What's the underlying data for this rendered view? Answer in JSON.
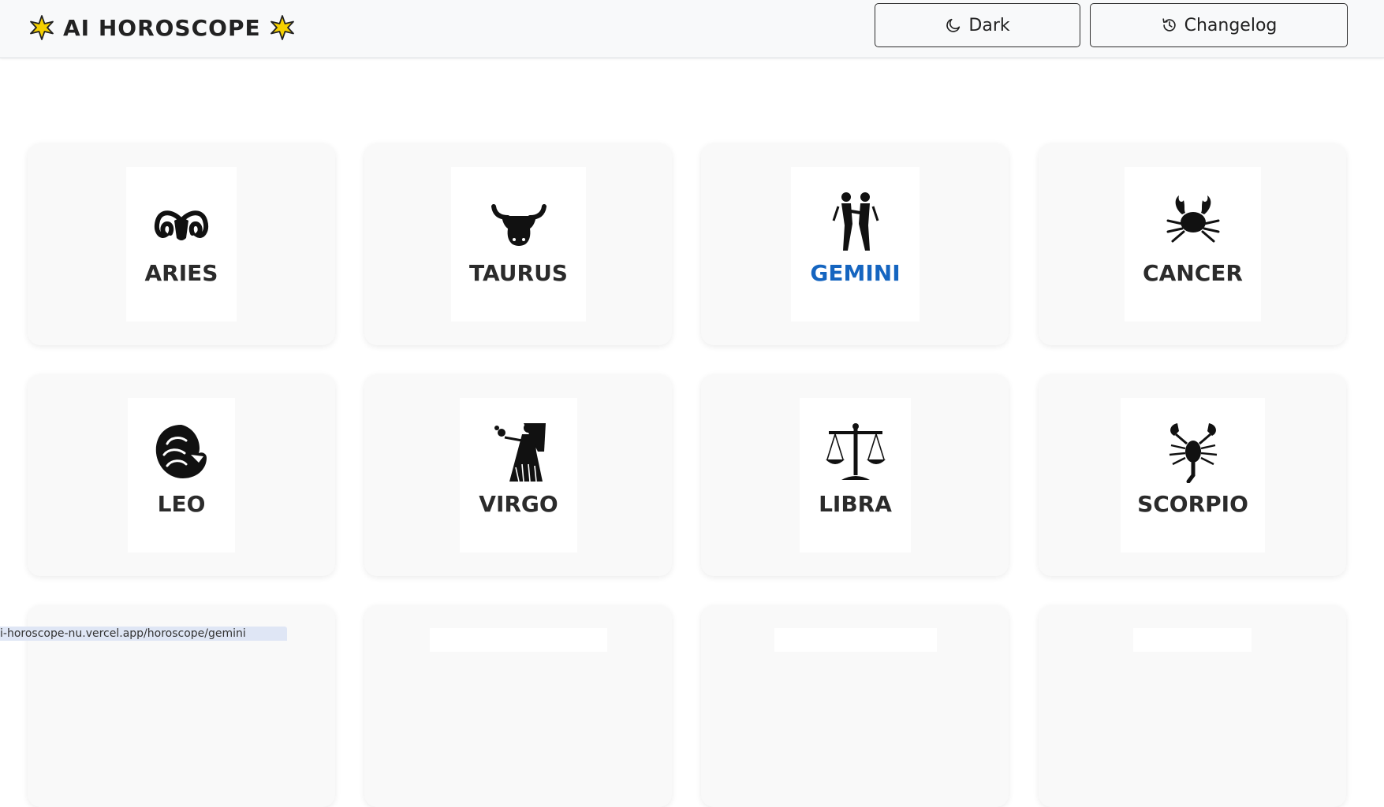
{
  "header": {
    "title": "AI HOROSCOPE",
    "dark_label": "Dark",
    "changelog_label": "Changelog"
  },
  "signs": [
    {
      "name": "ARIES",
      "icon": "ram-icon"
    },
    {
      "name": "TAURUS",
      "icon": "bull-icon"
    },
    {
      "name": "GEMINI",
      "icon": "twins-icon",
      "active": true
    },
    {
      "name": "CANCER",
      "icon": "crab-icon"
    },
    {
      "name": "LEO",
      "icon": "lion-icon"
    },
    {
      "name": "VIRGO",
      "icon": "maiden-icon"
    },
    {
      "name": "LIBRA",
      "icon": "scales-icon"
    },
    {
      "name": "SCORPIO",
      "icon": "scorpion-icon"
    }
  ],
  "status_bar": {
    "url": "i-horoscope-nu.vercel.app/horoscope/gemini"
  },
  "colors": {
    "active": "#1565c0",
    "star": "#f5d000"
  }
}
